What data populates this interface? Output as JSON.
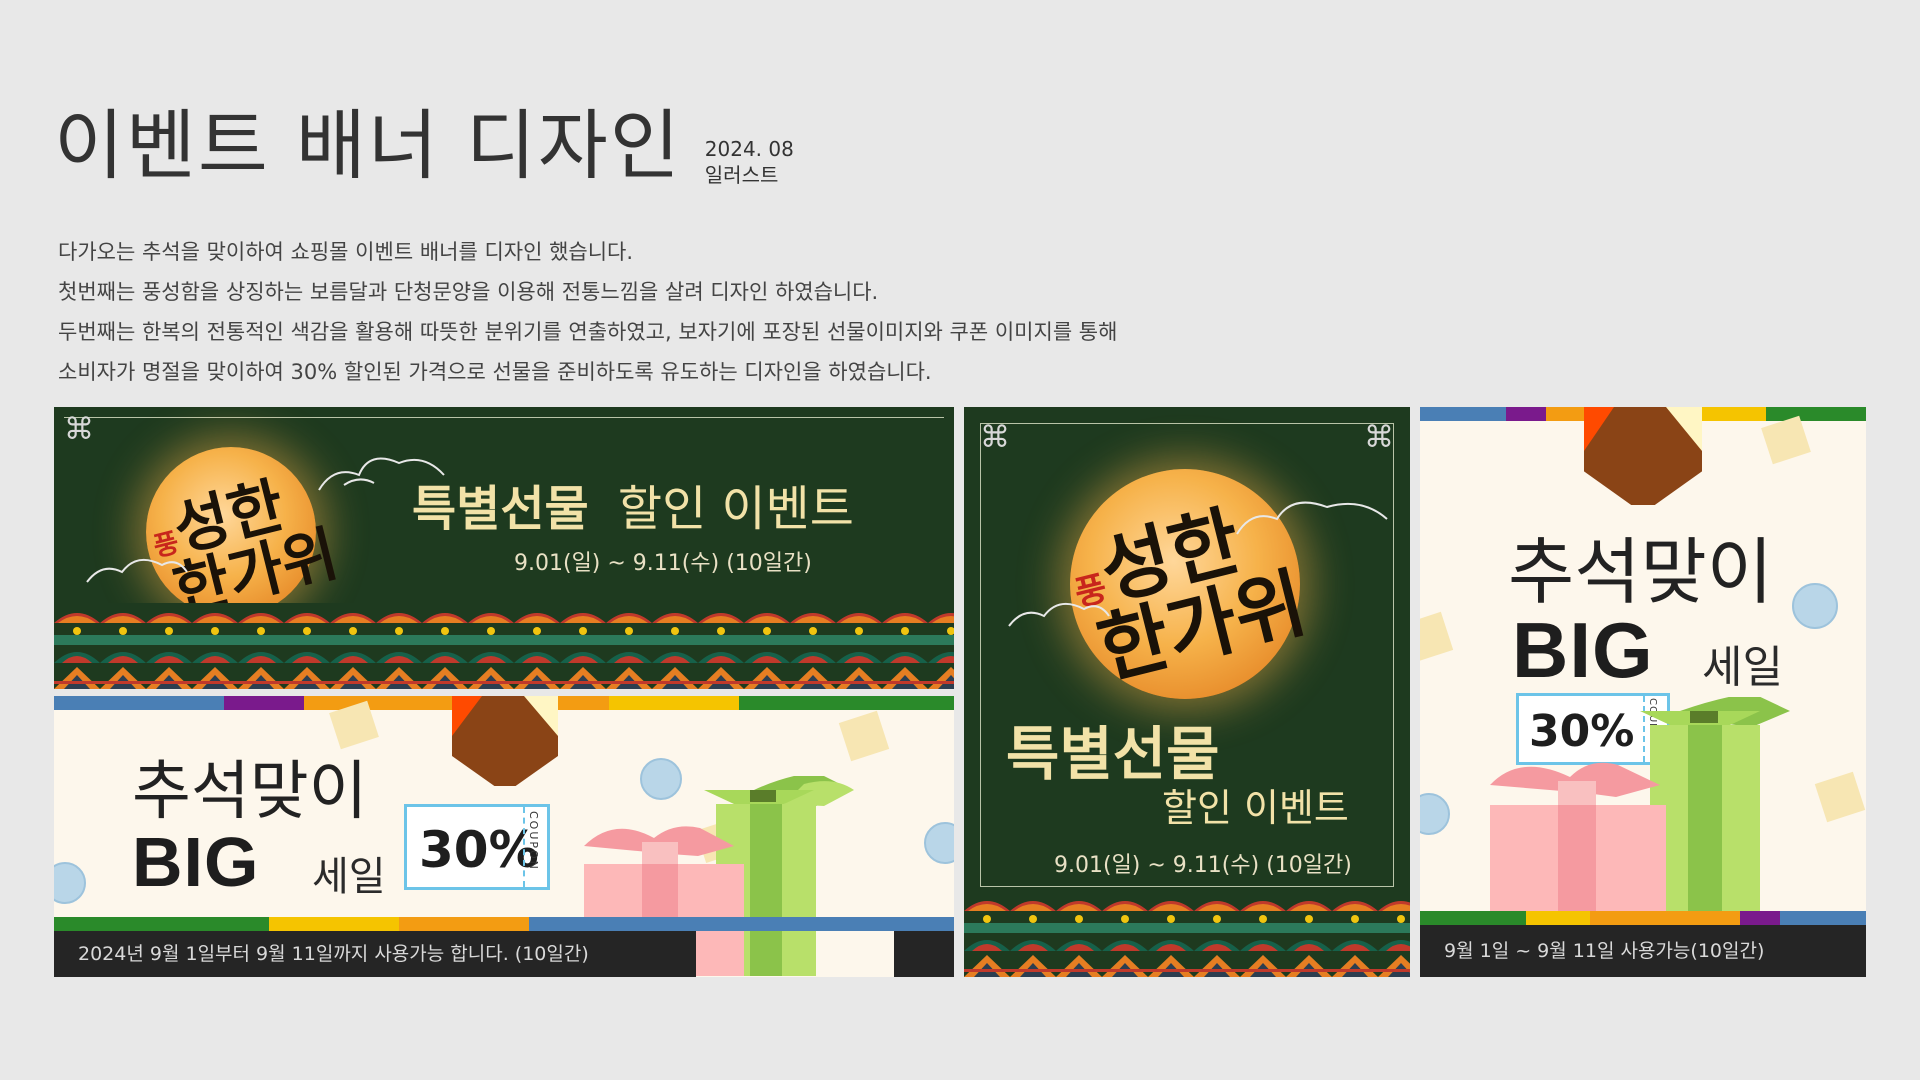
{
  "header": {
    "title": "이벤트 배너 디자인",
    "date": "2024. 08",
    "category": "일러스트"
  },
  "description": [
    "다가오는 추석을 맞이하여 쇼핑몰 이벤트 배너를 디자인 했습니다.",
    "첫번째는 풍성함을 상징하는 보름달과 단청문양을 이용해 전통느낌을 살려 디자인 하였습니다.",
    "두번째는 한복의 전통적인 색감을 활용해 따뜻한 분위기를 연출하였고, 보자기에 포장된 선물이미지와 쿠폰 이미지를 통해",
    "소비자가 명절을 맞이하여 30% 할인된 가격으로 선물을 준비하도록 유도하는 디자인을 하였습니다."
  ],
  "banner1": {
    "calligraphy_small": "풍",
    "calligraphy_main": "성한",
    "calligraphy_main2": "한가위",
    "title_bold": "특별선물",
    "title_light": "할인 이벤트",
    "date": "9.01(일) ~ 9.11(수) (10일간)"
  },
  "banner2": {
    "heading": "추석맞이",
    "big": "BIG",
    "sale": "세일",
    "coupon_pct": "30%",
    "coupon_label": "COUPON",
    "footer": "2024년 9월 1일부터 9월 11일까지 사용가능 합니다. (10일간)"
  },
  "banner3": {
    "calligraphy_small": "풍",
    "calligraphy_main": "성한",
    "calligraphy_main2": "한가위",
    "title_bold": "특별선물",
    "title_light": "할인 이벤트",
    "date": "9.01(일) ~ 9.11(수) (10일간)"
  },
  "banner4": {
    "heading": "추석맞이",
    "big": "BIG",
    "sale": "세일",
    "coupon_pct": "30%",
    "coupon_label": "COUPON",
    "footer": "9월 1일 ~ 9월 11일 사용가능(10일간)"
  },
  "colors": {
    "background": "#e8e8e8",
    "dark_green": "#1e3a1f",
    "cream": "#fdf7ec",
    "stripe_blue": "#4a7fb5",
    "stripe_purple": "#7a1a8c",
    "stripe_orange": "#f39c12",
    "stripe_yellow": "#f5c400",
    "stripe_green": "#2a8a2a",
    "gift_green": "#b8e06a",
    "gift_pink": "#f7a8a8",
    "coupon_border": "#6cc4e8"
  },
  "icons": [
    "moon-icon",
    "cloud-icon",
    "gift-box-icon",
    "coupon-icon",
    "traditional-corner-icon",
    "ddeok-icon"
  ]
}
